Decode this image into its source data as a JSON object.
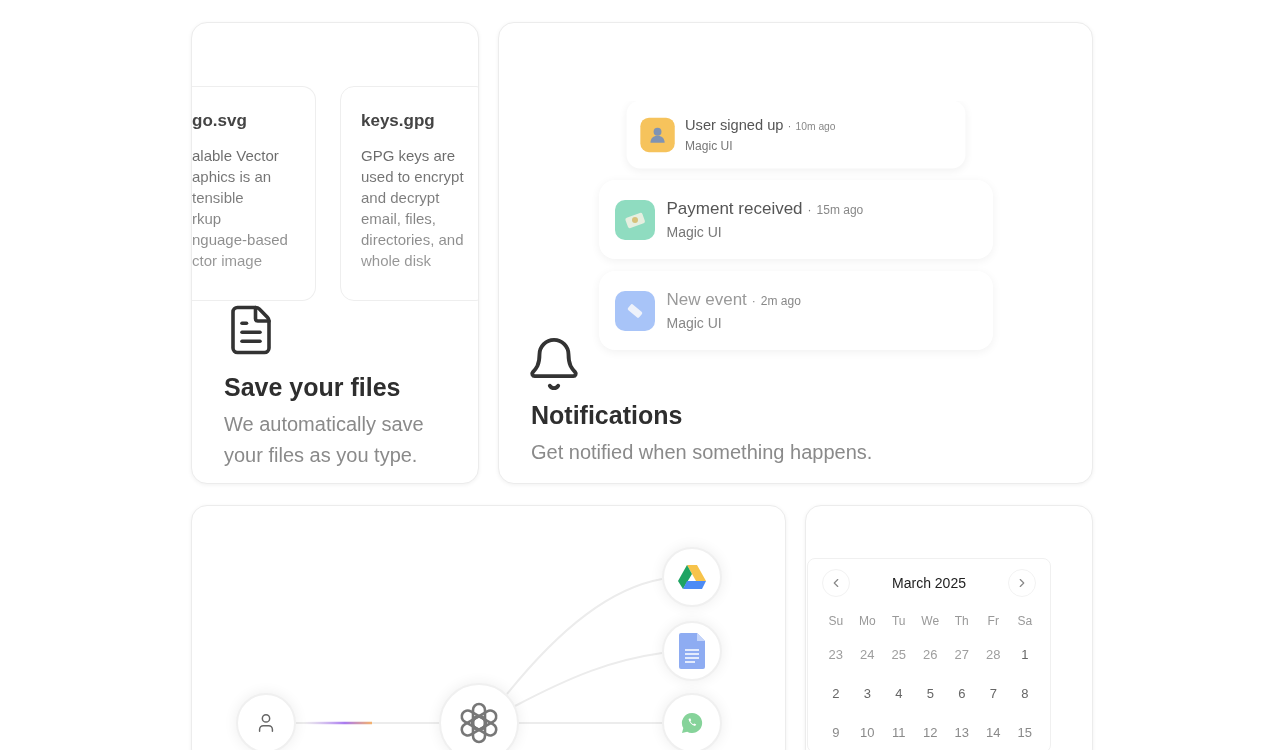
{
  "files_card": {
    "files": [
      {
        "name": "go.svg",
        "lines": [
          "alable Vector",
          "aphics is an",
          "tensible",
          "rkup",
          "nguage-based",
          "ctor image"
        ]
      },
      {
        "name": "keys.gpg",
        "lines": [
          "GPG keys are",
          "used to encrypt",
          "and decrypt",
          "email, files,",
          "directories, and",
          "whole disk"
        ]
      }
    ],
    "title": "Save your files",
    "description": "We automatically save your files as you type."
  },
  "notifications_card": {
    "items": [
      {
        "title": "User signed up",
        "separator": "·",
        "time": "10m ago",
        "app": "Magic UI",
        "color": "#f6c35c"
      },
      {
        "title": "Payment received",
        "separator": "·",
        "time": "15m ago",
        "app": "Magic UI",
        "color": "#8fdcc0"
      },
      {
        "title": "New event",
        "separator": "·",
        "time": "2m ago",
        "app": "Magic UI",
        "color": "#a8c4f8"
      }
    ],
    "title": "Notifications",
    "description": "Get notified when something happens."
  },
  "calendar": {
    "month": "March 2025",
    "weekdays": [
      "Su",
      "Mo",
      "Tu",
      "We",
      "Th",
      "Fr",
      "Sa"
    ],
    "days": [
      {
        "label": "23",
        "outside": true
      },
      {
        "label": "24",
        "outside": true
      },
      {
        "label": "25",
        "outside": true
      },
      {
        "label": "26",
        "outside": true
      },
      {
        "label": "27",
        "outside": true
      },
      {
        "label": "28",
        "outside": true
      },
      {
        "label": "1",
        "outside": false
      },
      {
        "label": "2",
        "outside": false
      },
      {
        "label": "3",
        "outside": false
      },
      {
        "label": "4",
        "outside": false
      },
      {
        "label": "5",
        "outside": false
      },
      {
        "label": "6",
        "outside": false
      },
      {
        "label": "7",
        "outside": false
      },
      {
        "label": "8",
        "outside": false
      },
      {
        "label": "9",
        "outside": false
      },
      {
        "label": "10",
        "outside": false
      },
      {
        "label": "11",
        "outside": false
      },
      {
        "label": "12",
        "outside": false
      },
      {
        "label": "13",
        "outside": false
      },
      {
        "label": "14",
        "outside": false
      },
      {
        "label": "15",
        "outside": false
      }
    ]
  }
}
